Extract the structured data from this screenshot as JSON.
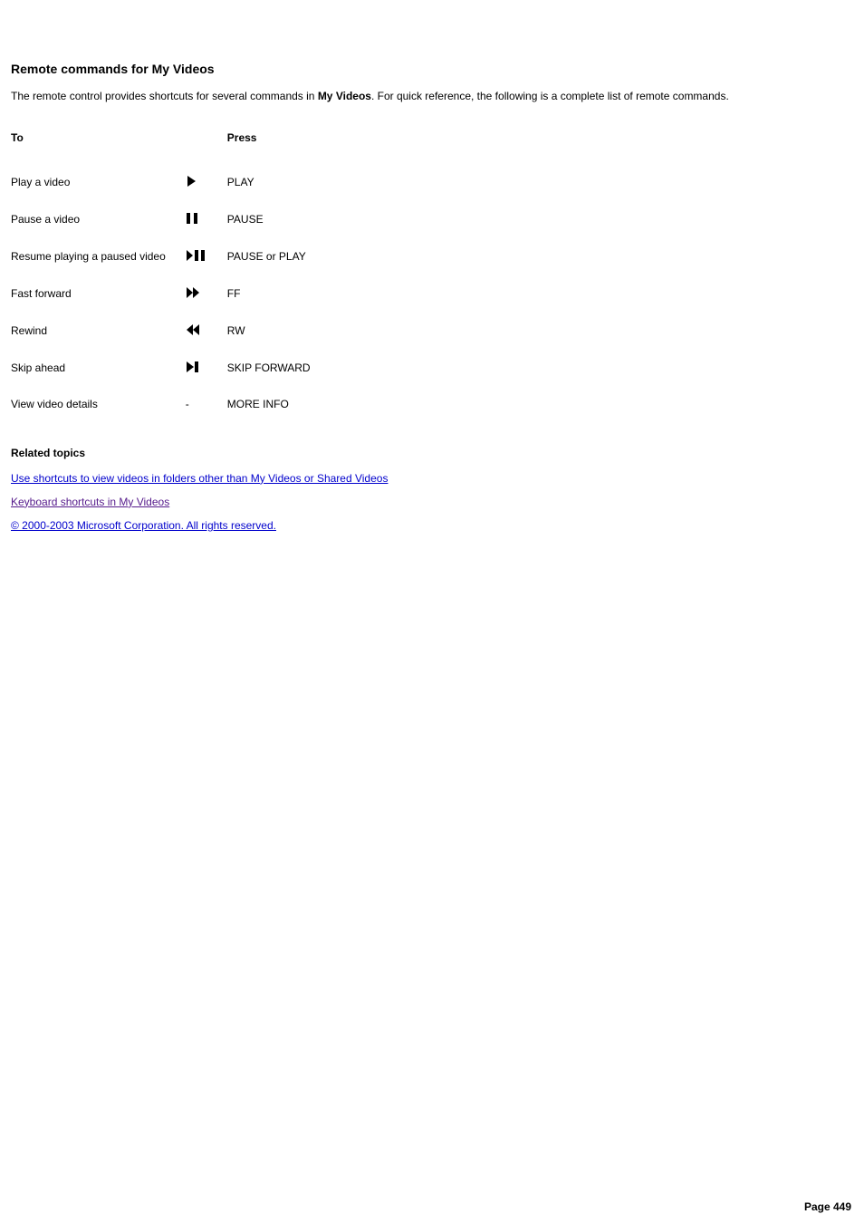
{
  "heading": "Remote commands for My Videos",
  "intro_pre": "The remote control provides shortcuts for several commands in ",
  "intro_bold": "My Videos",
  "intro_post": ". For quick reference, the following is a complete list of remote commands.",
  "table": {
    "header_to": "To",
    "header_press": "Press",
    "rows": [
      {
        "action": "Play a video",
        "icon": "play",
        "press": "PLAY"
      },
      {
        "action": "Pause a video",
        "icon": "pause",
        "press": "PAUSE"
      },
      {
        "action": "Resume playing a paused video",
        "icon": "playpause",
        "press": "PAUSE or PLAY"
      },
      {
        "action": "Fast forward",
        "icon": "ff",
        "press": "FF"
      },
      {
        "action": "Rewind",
        "icon": "rw",
        "press": "RW"
      },
      {
        "action": "Skip ahead",
        "icon": "skipfwd",
        "press": "SKIP FORWARD"
      },
      {
        "action": "View video details",
        "icon": "dash",
        "press": "MORE INFO"
      }
    ]
  },
  "related_heading": "Related topics",
  "links": {
    "shortcuts": "Use shortcuts to view videos in folders other than My Videos or Shared Videos",
    "keyboard": "Keyboard shortcuts in My Videos",
    "copyright": "© 2000-2003 Microsoft Corporation. All rights reserved."
  },
  "page_number": "Page 449"
}
